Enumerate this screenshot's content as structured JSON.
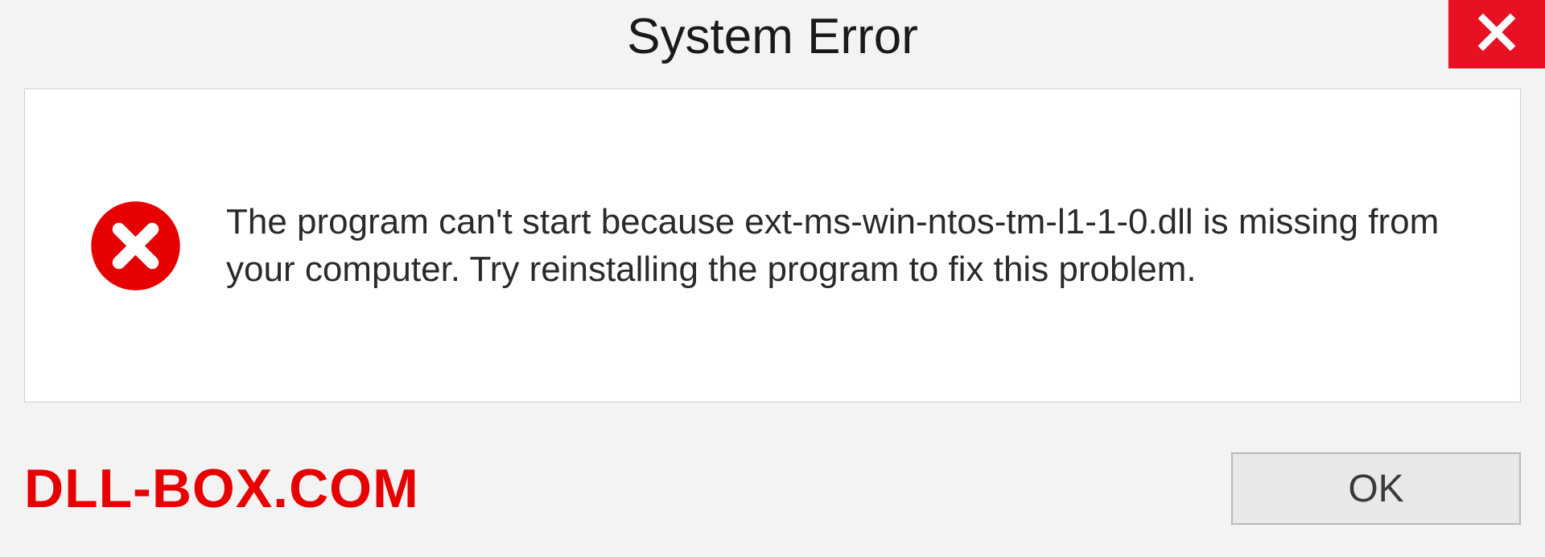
{
  "dialog": {
    "title": "System Error",
    "message": "The program can't start because ext-ms-win-ntos-tm-l1-1-0.dll is missing from your computer. Try reinstalling the program to fix this problem.",
    "ok_label": "OK"
  },
  "brand": "DLL-BOX.COM",
  "colors": {
    "close_bg": "#e81123",
    "error_icon": "#e60000",
    "brand": "#e60000"
  }
}
